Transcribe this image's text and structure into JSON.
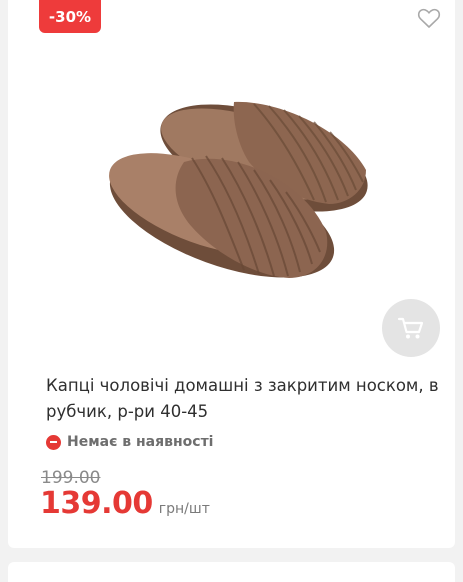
{
  "product": {
    "discount_badge": "-30%",
    "title": "Капці чоловічі домашні з закритим носком, в рубчик, р-ри 40-45",
    "availability": "Немає в наявності",
    "old_price": "199.00",
    "price": "139.00",
    "unit": "грн/шт",
    "icons": {
      "favorite": "heart-outline-icon",
      "cart": "cart-icon",
      "availability": "minus-circle-icon"
    },
    "colors": {
      "accent": "#e53935",
      "badge": "#ee3b3b",
      "cart_button_bg": "#e4e4e4"
    }
  }
}
